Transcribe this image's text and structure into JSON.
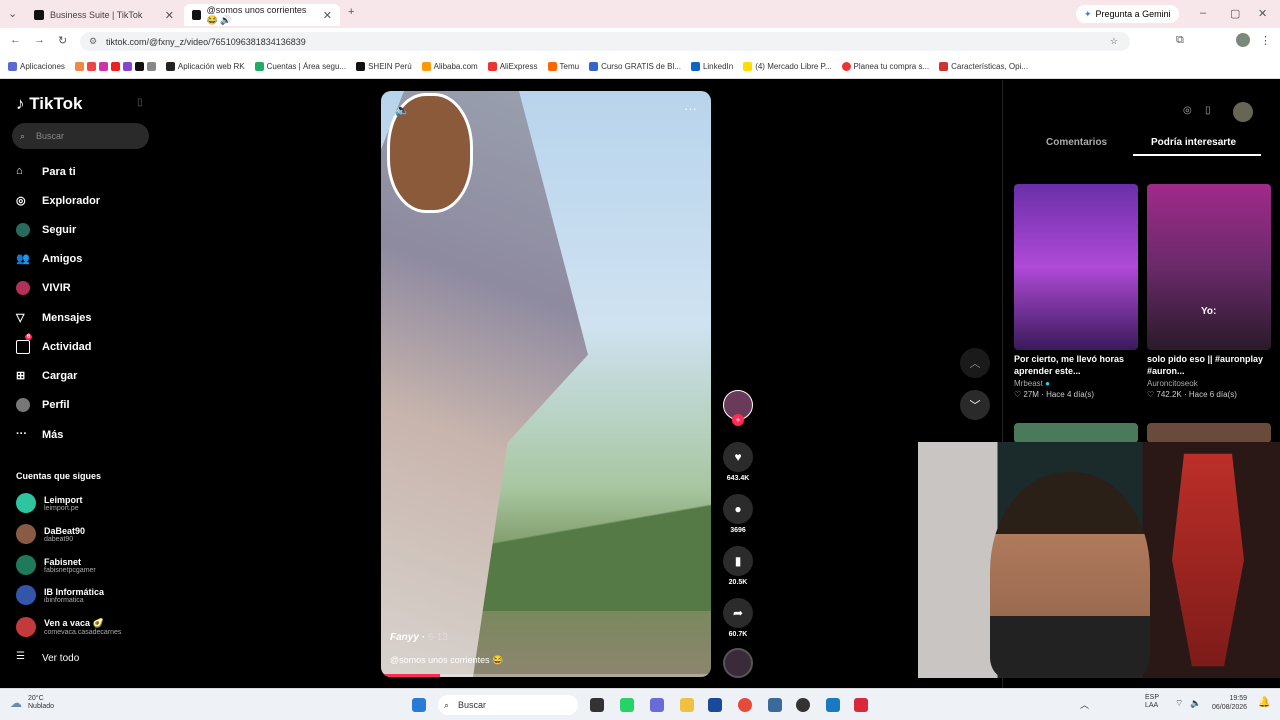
{
  "browser": {
    "tabs": [
      {
        "title": "Business Suite | TikTok",
        "active": false
      },
      {
        "title": "@somos unos corrientes 😂 🔊",
        "active": true
      }
    ],
    "new_tab": "+",
    "gemini": "Pregunta a Gemini",
    "url": "tiktok.com/@fxny_z/video/7651096381834136839",
    "bookmarks": [
      "Aplicaciones",
      "Aplicación web RK",
      "Cuentas | Área segu...",
      "SHEIN Perú",
      "Alibaba.com",
      "AliExpress",
      "Temu",
      "Curso GRATIS de Bl...",
      "LinkedIn",
      "(4) Mercado Libre P...",
      "Planea tu compra s...",
      "Características, Opi..."
    ]
  },
  "sidebar": {
    "logo": "TikTok",
    "search_placeholder": "Buscar",
    "nav": [
      {
        "label": "Para ti",
        "icon": "home-icon"
      },
      {
        "label": "Explorador",
        "icon": "compass-icon"
      },
      {
        "label": "Seguir",
        "icon": "following-icon"
      },
      {
        "label": "Amigos",
        "icon": "friends-icon"
      },
      {
        "label": "VIVIR",
        "icon": "live-icon"
      },
      {
        "label": "Mensajes",
        "icon": "messages-icon"
      },
      {
        "label": "Actividad",
        "icon": "activity-icon",
        "badge": "6"
      },
      {
        "label": "Cargar",
        "icon": "upload-icon"
      },
      {
        "label": "Perfil",
        "icon": "profile-icon"
      },
      {
        "label": "Más",
        "icon": "more-icon"
      }
    ],
    "following_title": "Cuentas que sigues",
    "accounts": [
      {
        "name": "Leimport",
        "user": "leimport.pe",
        "color": "#2ec4a0"
      },
      {
        "name": "DaBeat90",
        "user": "dabeat90",
        "color": "#8a5a44"
      },
      {
        "name": "Fabisnet",
        "user": "fabisnetpcgamer",
        "color": "#1e7a5a"
      },
      {
        "name": "IB Informática",
        "user": "ibinformatica",
        "color": "#3355aa"
      },
      {
        "name": "Ven a vaca 🥑",
        "user": "comevaca.casadecarnes",
        "color": "#c23a3a"
      }
    ],
    "see_all": "Ver todo"
  },
  "video": {
    "author": "Fanyy",
    "date": "6-13",
    "caption": "@somos unos corrientes 😂",
    "progress": 0.18
  },
  "actions": {
    "likes": "643.4K",
    "comments": "3696",
    "saves": "20.5K",
    "shares": "60.7K"
  },
  "right_panel": {
    "tabs": [
      "Comentarios",
      "Podría interesarte"
    ],
    "cards": [
      {
        "title": "Por cierto, me llevó horas aprender este...",
        "author": "Mrbeast",
        "stats": "♡ 27M · Hace 4 día(s)",
        "color": "#7a2fb8"
      },
      {
        "title": "solo pido eso || #auronplay #auron...",
        "author": "Auroncitoseok",
        "stats": "♡ 742.2K · Hace 6 día(s)",
        "color": "#b03a8a",
        "overlay": "Yo:"
      }
    ]
  },
  "taskbar": {
    "weather_temp": "20°C",
    "weather_desc": "Nublado",
    "search": "Buscar",
    "lang": "ESP LAA",
    "time": "19:59",
    "date": "06/08/2026"
  }
}
